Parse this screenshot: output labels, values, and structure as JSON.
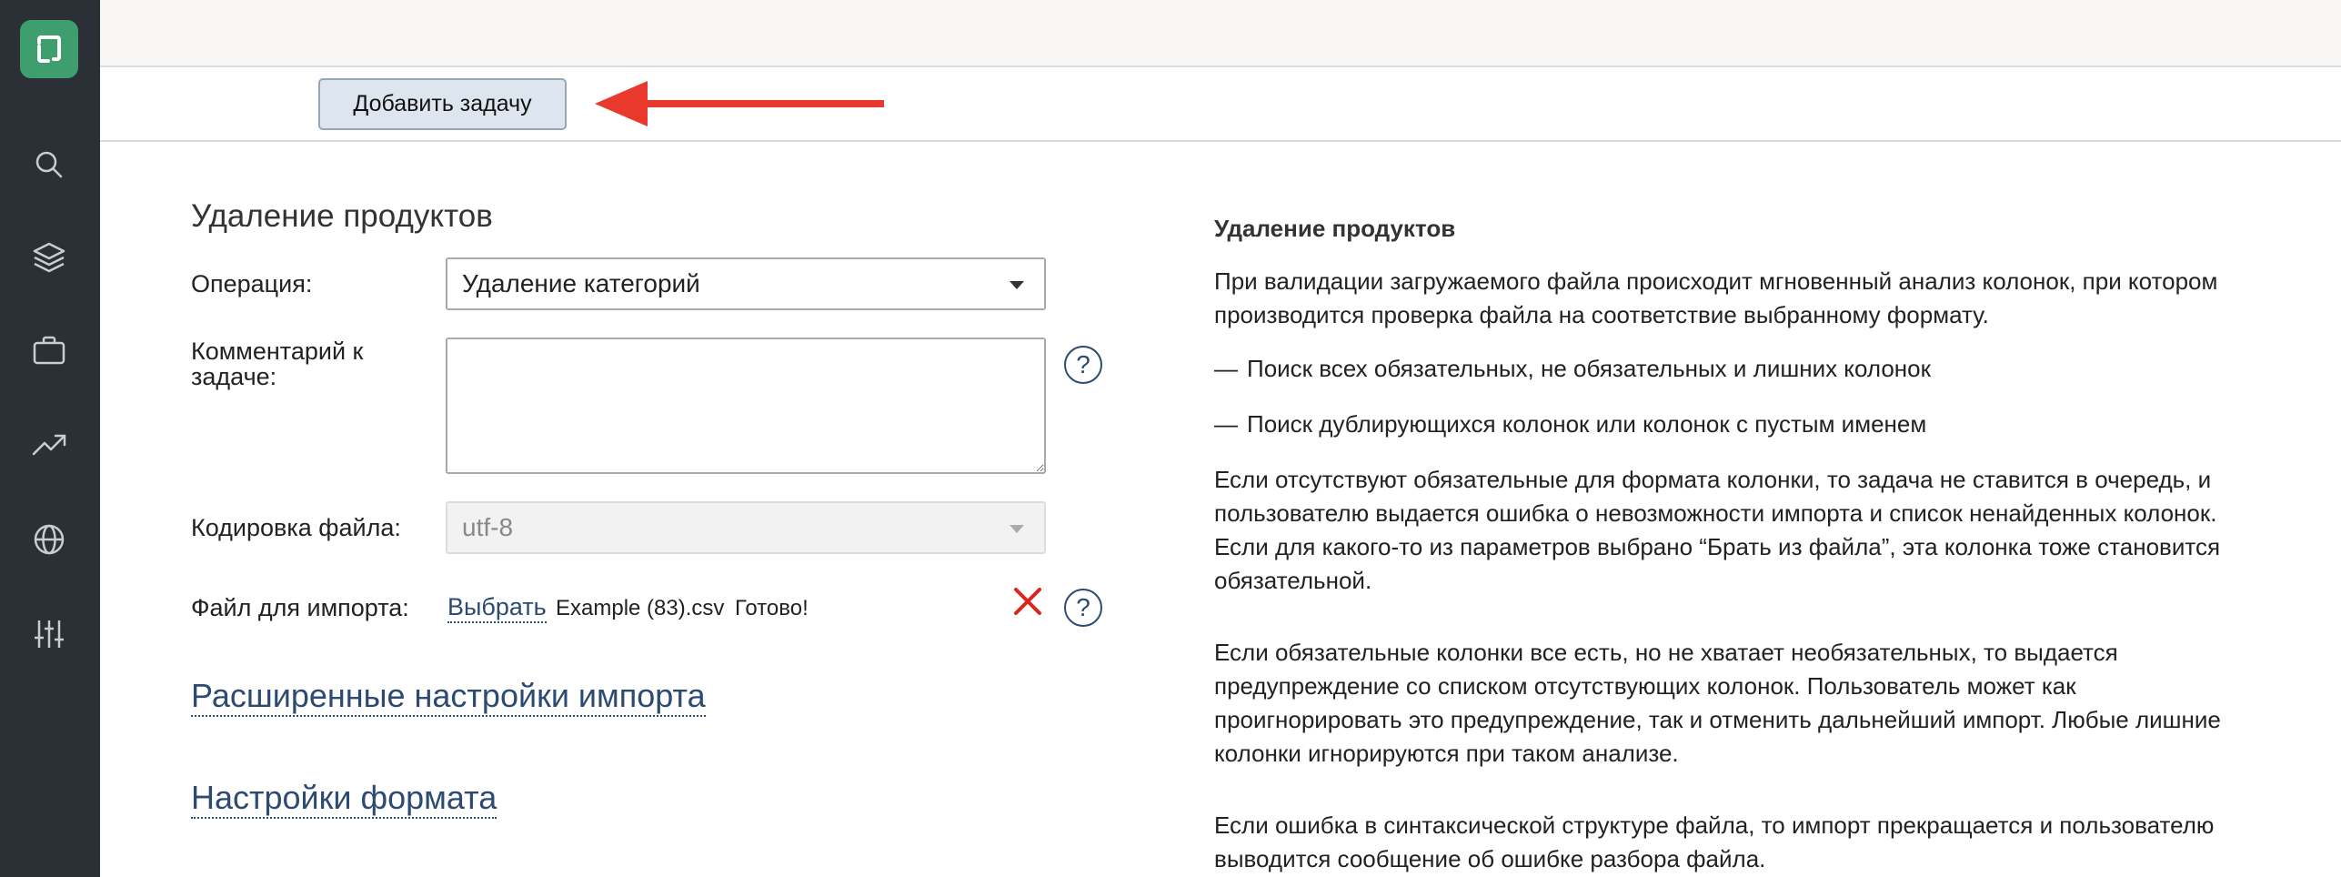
{
  "sidebar": {
    "icons": [
      "app-logo",
      "search-icon",
      "layers-icon",
      "briefcase-icon",
      "trending-up-icon",
      "globe-icon",
      "sliders-icon"
    ],
    "accent": "#3f9e6e"
  },
  "toolbar": {
    "add_task_label": "Добавить задачу"
  },
  "form": {
    "title": "Удаление продуктов",
    "operation_label": "Операция:",
    "operation_value": "Удаление категорий",
    "comment_label": "Комментарий к задаче:",
    "comment_value": "",
    "encoding_label": "Кодировка файла:",
    "encoding_value": "utf-8",
    "file_label": "Файл для импорта:",
    "file_choose": "Выбрать",
    "file_name": "Example (83).csv",
    "file_status": "Готово!",
    "help_symbol": "?",
    "advanced_settings": "Расширенные настройки импорта",
    "format_settings": "Настройки формата"
  },
  "info": {
    "title": "Удаление продуктов",
    "intro": "При валидации загружаемого файла происходит мгновенный анализ колонок, при котором производится проверка файла на соответствие выбранному формату.",
    "bullets": [
      "Поиск всех обязательных, не обязательных и лишних колонок",
      "Поиск дублирующихся колонок или колонок с пустым именем"
    ],
    "p1": "Если отсутствуют обязательные для формата колонки, то задача не ставится в очередь, и пользователю выдается ошибка о невозможности импорта и список ненайденных колонок. Если для какого-то из параметров выбрано “Брать из файла”, эта колонка тоже становится обязательной.",
    "p2": "Если обязательные колонки все есть, но не хватает необязательных, то выдается предупреждение со списком отсутствующих колонок. Пользователь может как проигнорировать это предупреждение, так и отменить дальнейший импорт. Любые лишние колонки игнорируются при таком анализе.",
    "p3": "Если ошибка в синтаксической структуре файла, то импорт прекращается и пользователю выводится сообщение об ошибке разбора файла."
  },
  "colors": {
    "sidebar_bg": "#2b2f36",
    "link": "#2d4b72",
    "arrow": "#e8392c",
    "remove": "#d9261c"
  }
}
